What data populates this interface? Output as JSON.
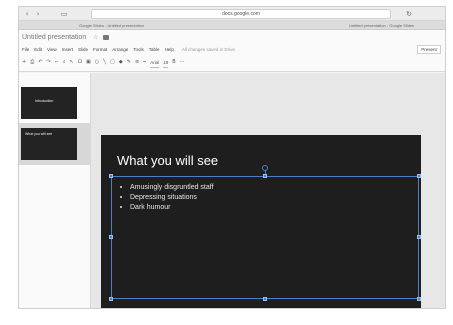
{
  "browser": {
    "url": "docs.google.com",
    "tabs": [
      "Google Slides - Untitled presentation",
      "Untitled presentation - Google Slides"
    ]
  },
  "app": {
    "doc_title": "Untitled presentation",
    "menus": [
      "File",
      "Edit",
      "View",
      "Insert",
      "Slide",
      "Format",
      "Arrange",
      "Tools",
      "Table",
      "Help"
    ],
    "save_status": "All changes saved in Drive",
    "present_label": "Present",
    "font_name": "Arial",
    "font_size": "18"
  },
  "filmstrip": {
    "slides": [
      {
        "number": "1",
        "title": "Introduction"
      },
      {
        "number": "2",
        "title": "What you will see"
      }
    ]
  },
  "slide": {
    "title": "What you will see",
    "bullets": [
      "Amusingly disgruntled staff",
      "Depressing situations",
      "Dark humour"
    ]
  }
}
